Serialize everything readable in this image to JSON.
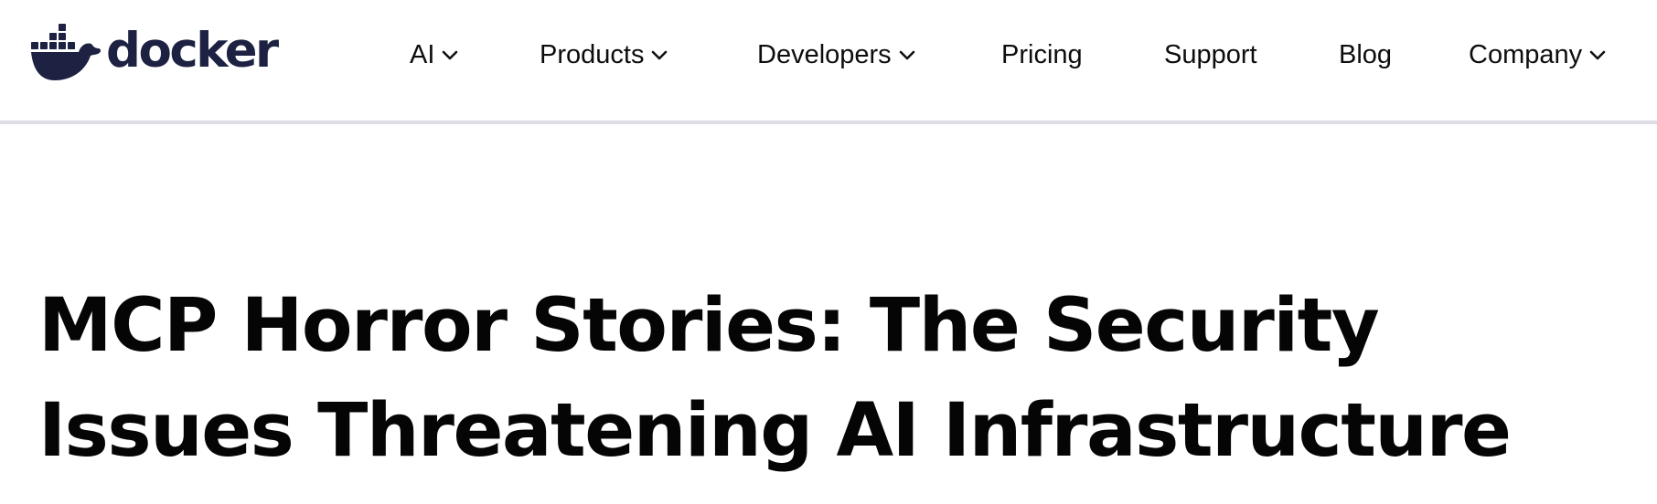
{
  "brand": {
    "name": "docker",
    "logo_icon": "docker-whale-icon",
    "color": "#1d2142"
  },
  "nav": {
    "items": [
      {
        "label": "AI",
        "has_dropdown": true
      },
      {
        "label": "Products",
        "has_dropdown": true
      },
      {
        "label": "Developers",
        "has_dropdown": true
      },
      {
        "label": "Pricing",
        "has_dropdown": false
      },
      {
        "label": "Support",
        "has_dropdown": false
      },
      {
        "label": "Blog",
        "has_dropdown": false
      },
      {
        "label": "Company",
        "has_dropdown": true
      }
    ],
    "dropdown_icon": "chevron-down-icon",
    "divider_color": "#dcdce4"
  },
  "article": {
    "title_lines": [
      "MCP Horror Stories: The Security",
      "Issues Threatening AI Infrastructure"
    ]
  }
}
